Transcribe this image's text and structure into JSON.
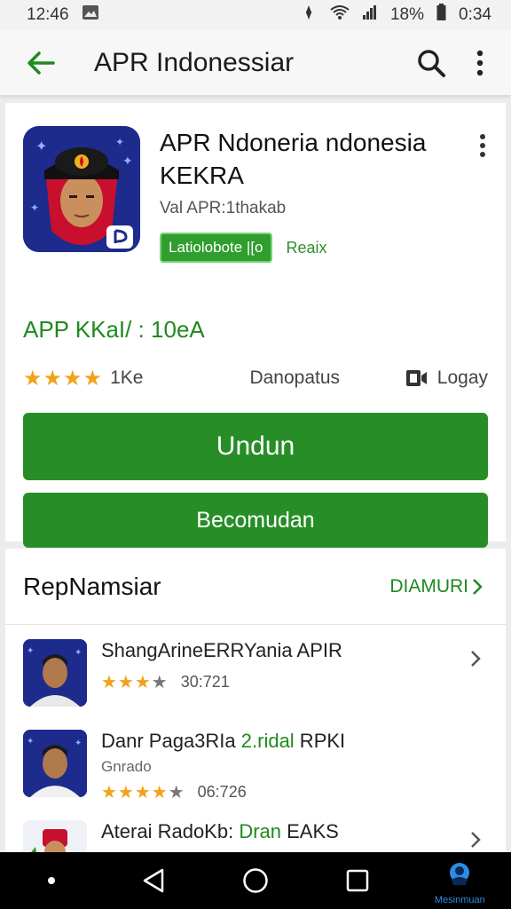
{
  "status_bar": {
    "time": "12:46",
    "battery_text": "18%",
    "clock_right": "0:34"
  },
  "app_bar": {
    "title": "APR Indonessiar"
  },
  "app": {
    "name_line1": "APR Ndoneria ndonesia",
    "name_line2": "KEKRA",
    "developer": "Val APR:1thakab",
    "badge": "Latiolobote |[o",
    "tag": "Reaix",
    "version": "APP KKaI/ : 10eA",
    "rating_count": "1Ke",
    "downloads": "Danopatus",
    "legacy": "Logay"
  },
  "buttons": {
    "install": "Undun",
    "open": "Becomudan"
  },
  "related": {
    "title": "RepNamsiar",
    "more": "DIAMURI",
    "items": [
      {
        "title": "ShangArineERRYania APIR",
        "title_green": "",
        "title_tail": "",
        "subtitle": "",
        "rating_count": "30:721"
      },
      {
        "title": "Danr Paga3RIa ",
        "title_green": "2.ridal",
        "title_tail": " RPKI",
        "subtitle": "Gnrado",
        "rating_count": "06:726"
      },
      {
        "title": "Aterai RadoKb: ",
        "title_green": "Dran",
        "title_tail": " EAKS",
        "subtitle": "",
        "rating_count": ""
      }
    ]
  },
  "nav": {
    "label": "Mesinmuan"
  },
  "colors": {
    "accent": "#278e27",
    "star": "#f2a21a",
    "icon_bg": "#1d2b8c"
  }
}
